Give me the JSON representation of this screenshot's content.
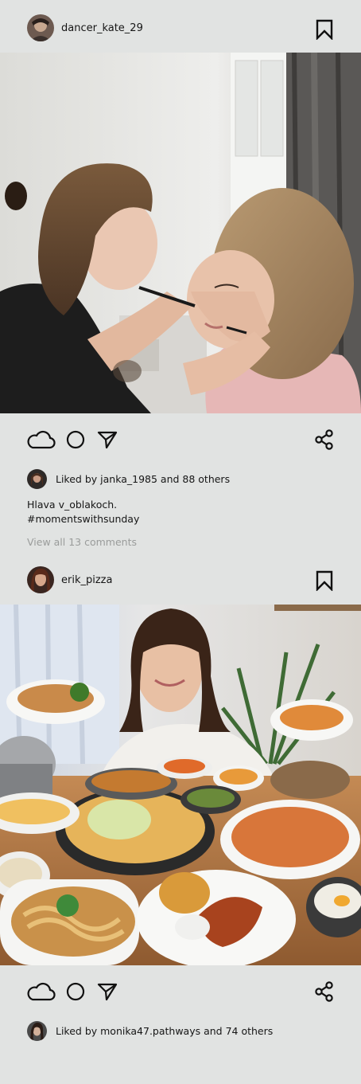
{
  "colors": {
    "background": "#e1e3e2",
    "text": "#161616",
    "muted": "#9a9c9b"
  },
  "posts": [
    {
      "username": "dancer_kate_29",
      "image": "makeup-artist-applying-eyeliner-photo",
      "likes_text": "Liked by janka_1985 and 88 others",
      "caption_lines": [
        "Hlava v_oblakoch.",
        "#momentswithsunday"
      ],
      "comments_link": "View all 13 comments"
    },
    {
      "username": "erik_pizza",
      "image": "woman-with-table-full-of-food-photo",
      "likes_text": "Liked by monika47.pathways and 74 others"
    }
  ],
  "icons": [
    "cloud-icon",
    "circle-icon",
    "send-icon",
    "share-icon",
    "bookmark-icon"
  ]
}
